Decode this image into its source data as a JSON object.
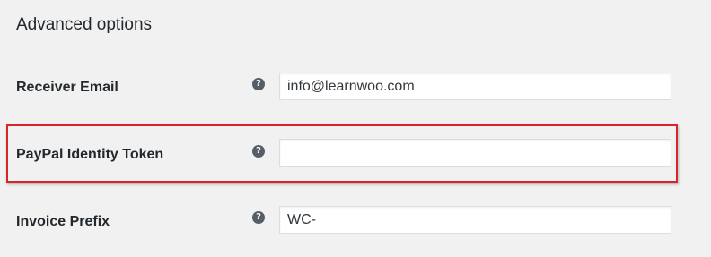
{
  "section": {
    "title": "Advanced options"
  },
  "fields": [
    {
      "label": "Receiver Email",
      "value": "info@learnwoo.com",
      "help_icon": "question-circle-icon",
      "help_glyph": "?"
    },
    {
      "label": "PayPal Identity Token",
      "value": "",
      "help_icon": "question-circle-icon",
      "help_glyph": "?"
    },
    {
      "label": "Invoice Prefix",
      "value": "WC-",
      "help_icon": "question-circle-icon",
      "help_glyph": "?"
    }
  ],
  "colors": {
    "background": "#f1f1f1",
    "highlight": "#d9252a",
    "help_icon": "#555d66"
  }
}
